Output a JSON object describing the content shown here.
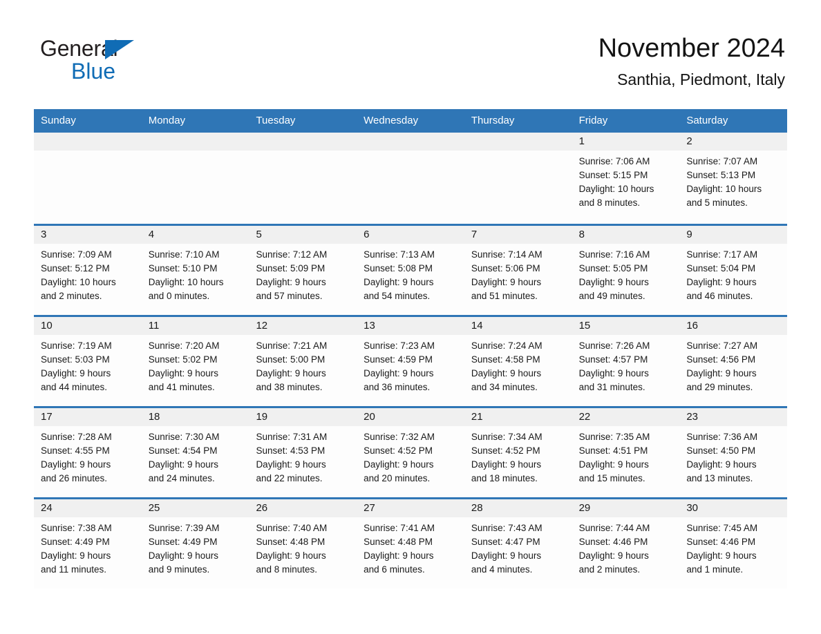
{
  "logo": {
    "word1": "General",
    "word2": "Blue",
    "triangle_color": "#106cb5"
  },
  "header": {
    "title": "November 2024",
    "subtitle": "Santhia, Piedmont, Italy"
  },
  "theme": {
    "header_blue": "#2f76b6",
    "daynum_band": "#f0f0f0",
    "cell_background": "#fdfdfd",
    "text": "#1a1a1a"
  },
  "weekdays": [
    "Sunday",
    "Monday",
    "Tuesday",
    "Wednesday",
    "Thursday",
    "Friday",
    "Saturday"
  ],
  "weeks": [
    [
      {
        "day": "",
        "empty": true
      },
      {
        "day": "",
        "empty": true
      },
      {
        "day": "",
        "empty": true
      },
      {
        "day": "",
        "empty": true
      },
      {
        "day": "",
        "empty": true
      },
      {
        "day": "1",
        "sunrise": "Sunrise: 7:06 AM",
        "sunset": "Sunset: 5:15 PM",
        "daylight1": "Daylight: 10 hours",
        "daylight2": "and 8 minutes."
      },
      {
        "day": "2",
        "sunrise": "Sunrise: 7:07 AM",
        "sunset": "Sunset: 5:13 PM",
        "daylight1": "Daylight: 10 hours",
        "daylight2": "and 5 minutes."
      }
    ],
    [
      {
        "day": "3",
        "sunrise": "Sunrise: 7:09 AM",
        "sunset": "Sunset: 5:12 PM",
        "daylight1": "Daylight: 10 hours",
        "daylight2": "and 2 minutes."
      },
      {
        "day": "4",
        "sunrise": "Sunrise: 7:10 AM",
        "sunset": "Sunset: 5:10 PM",
        "daylight1": "Daylight: 10 hours",
        "daylight2": "and 0 minutes."
      },
      {
        "day": "5",
        "sunrise": "Sunrise: 7:12 AM",
        "sunset": "Sunset: 5:09 PM",
        "daylight1": "Daylight: 9 hours",
        "daylight2": "and 57 minutes."
      },
      {
        "day": "6",
        "sunrise": "Sunrise: 7:13 AM",
        "sunset": "Sunset: 5:08 PM",
        "daylight1": "Daylight: 9 hours",
        "daylight2": "and 54 minutes."
      },
      {
        "day": "7",
        "sunrise": "Sunrise: 7:14 AM",
        "sunset": "Sunset: 5:06 PM",
        "daylight1": "Daylight: 9 hours",
        "daylight2": "and 51 minutes."
      },
      {
        "day": "8",
        "sunrise": "Sunrise: 7:16 AM",
        "sunset": "Sunset: 5:05 PM",
        "daylight1": "Daylight: 9 hours",
        "daylight2": "and 49 minutes."
      },
      {
        "day": "9",
        "sunrise": "Sunrise: 7:17 AM",
        "sunset": "Sunset: 5:04 PM",
        "daylight1": "Daylight: 9 hours",
        "daylight2": "and 46 minutes."
      }
    ],
    [
      {
        "day": "10",
        "sunrise": "Sunrise: 7:19 AM",
        "sunset": "Sunset: 5:03 PM",
        "daylight1": "Daylight: 9 hours",
        "daylight2": "and 44 minutes."
      },
      {
        "day": "11",
        "sunrise": "Sunrise: 7:20 AM",
        "sunset": "Sunset: 5:02 PM",
        "daylight1": "Daylight: 9 hours",
        "daylight2": "and 41 minutes."
      },
      {
        "day": "12",
        "sunrise": "Sunrise: 7:21 AM",
        "sunset": "Sunset: 5:00 PM",
        "daylight1": "Daylight: 9 hours",
        "daylight2": "and 38 minutes."
      },
      {
        "day": "13",
        "sunrise": "Sunrise: 7:23 AM",
        "sunset": "Sunset: 4:59 PM",
        "daylight1": "Daylight: 9 hours",
        "daylight2": "and 36 minutes."
      },
      {
        "day": "14",
        "sunrise": "Sunrise: 7:24 AM",
        "sunset": "Sunset: 4:58 PM",
        "daylight1": "Daylight: 9 hours",
        "daylight2": "and 34 minutes."
      },
      {
        "day": "15",
        "sunrise": "Sunrise: 7:26 AM",
        "sunset": "Sunset: 4:57 PM",
        "daylight1": "Daylight: 9 hours",
        "daylight2": "and 31 minutes."
      },
      {
        "day": "16",
        "sunrise": "Sunrise: 7:27 AM",
        "sunset": "Sunset: 4:56 PM",
        "daylight1": "Daylight: 9 hours",
        "daylight2": "and 29 minutes."
      }
    ],
    [
      {
        "day": "17",
        "sunrise": "Sunrise: 7:28 AM",
        "sunset": "Sunset: 4:55 PM",
        "daylight1": "Daylight: 9 hours",
        "daylight2": "and 26 minutes."
      },
      {
        "day": "18",
        "sunrise": "Sunrise: 7:30 AM",
        "sunset": "Sunset: 4:54 PM",
        "daylight1": "Daylight: 9 hours",
        "daylight2": "and 24 minutes."
      },
      {
        "day": "19",
        "sunrise": "Sunrise: 7:31 AM",
        "sunset": "Sunset: 4:53 PM",
        "daylight1": "Daylight: 9 hours",
        "daylight2": "and 22 minutes."
      },
      {
        "day": "20",
        "sunrise": "Sunrise: 7:32 AM",
        "sunset": "Sunset: 4:52 PM",
        "daylight1": "Daylight: 9 hours",
        "daylight2": "and 20 minutes."
      },
      {
        "day": "21",
        "sunrise": "Sunrise: 7:34 AM",
        "sunset": "Sunset: 4:52 PM",
        "daylight1": "Daylight: 9 hours",
        "daylight2": "and 18 minutes."
      },
      {
        "day": "22",
        "sunrise": "Sunrise: 7:35 AM",
        "sunset": "Sunset: 4:51 PM",
        "daylight1": "Daylight: 9 hours",
        "daylight2": "and 15 minutes."
      },
      {
        "day": "23",
        "sunrise": "Sunrise: 7:36 AM",
        "sunset": "Sunset: 4:50 PM",
        "daylight1": "Daylight: 9 hours",
        "daylight2": "and 13 minutes."
      }
    ],
    [
      {
        "day": "24",
        "sunrise": "Sunrise: 7:38 AM",
        "sunset": "Sunset: 4:49 PM",
        "daylight1": "Daylight: 9 hours",
        "daylight2": "and 11 minutes."
      },
      {
        "day": "25",
        "sunrise": "Sunrise: 7:39 AM",
        "sunset": "Sunset: 4:49 PM",
        "daylight1": "Daylight: 9 hours",
        "daylight2": "and 9 minutes."
      },
      {
        "day": "26",
        "sunrise": "Sunrise: 7:40 AM",
        "sunset": "Sunset: 4:48 PM",
        "daylight1": "Daylight: 9 hours",
        "daylight2": "and 8 minutes."
      },
      {
        "day": "27",
        "sunrise": "Sunrise: 7:41 AM",
        "sunset": "Sunset: 4:48 PM",
        "daylight1": "Daylight: 9 hours",
        "daylight2": "and 6 minutes."
      },
      {
        "day": "28",
        "sunrise": "Sunrise: 7:43 AM",
        "sunset": "Sunset: 4:47 PM",
        "daylight1": "Daylight: 9 hours",
        "daylight2": "and 4 minutes."
      },
      {
        "day": "29",
        "sunrise": "Sunrise: 7:44 AM",
        "sunset": "Sunset: 4:46 PM",
        "daylight1": "Daylight: 9 hours",
        "daylight2": "and 2 minutes."
      },
      {
        "day": "30",
        "sunrise": "Sunrise: 7:45 AM",
        "sunset": "Sunset: 4:46 PM",
        "daylight1": "Daylight: 9 hours",
        "daylight2": "and 1 minute."
      }
    ]
  ]
}
